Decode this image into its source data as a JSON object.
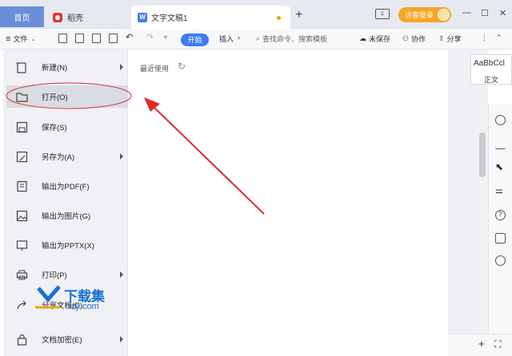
{
  "tabs": {
    "home": "首页",
    "docer": "稻壳",
    "document": "文字文稿1",
    "new_tab": "+"
  },
  "window": {
    "layout_badge": "1",
    "login_label": "访客登录",
    "minimize": "—",
    "maximize": "☐",
    "close": "✕"
  },
  "toolbar": {
    "menu_label": "文件",
    "start_label": "开始",
    "insert_label": "插入",
    "search_placeholder": "查找命令、搜索模板",
    "unsaved_label": "未保存",
    "collab_label": "协作",
    "share_label": "分享",
    "more": "⋮"
  },
  "styles": {
    "sample": "AaBbCcl",
    "name": "正文"
  },
  "file_menu": {
    "items": [
      {
        "label": "新建(N)",
        "icon": "new-document-icon",
        "has_submenu": true
      },
      {
        "label": "打开(O)",
        "icon": "folder-open-icon",
        "has_submenu": false,
        "active": true
      },
      {
        "label": "保存(S)",
        "icon": "save-icon",
        "has_submenu": false
      },
      {
        "label": "另存为(A)",
        "icon": "save-as-icon",
        "has_submenu": true
      },
      {
        "label": "输出为PDF(F)",
        "icon": "export-pdf-icon",
        "has_submenu": false
      },
      {
        "label": "输出为图片(G)",
        "icon": "export-image-icon",
        "has_submenu": false
      },
      {
        "label": "输出为PPTX(X)",
        "icon": "export-pptx-icon",
        "has_submenu": false
      },
      {
        "label": "打印(P)",
        "icon": "print-icon",
        "has_submenu": true
      },
      {
        "label": "分享文档(D)",
        "icon": "share-document-icon",
        "has_submenu": false
      },
      {
        "label": "文档加密(E)",
        "icon": "lock-icon",
        "has_submenu": true
      }
    ]
  },
  "recent": {
    "title": "最近使用"
  },
  "watermark": {
    "brand": "下载集",
    "url": "xzji.com"
  },
  "bottom": {
    "zoom_in": "+",
    "fullscreen": "⛶"
  },
  "colors": {
    "accent": "#3f7cf2",
    "home_tab": "#6b8ed8",
    "login": "#f5a623",
    "annotation": "#e02a2a"
  }
}
